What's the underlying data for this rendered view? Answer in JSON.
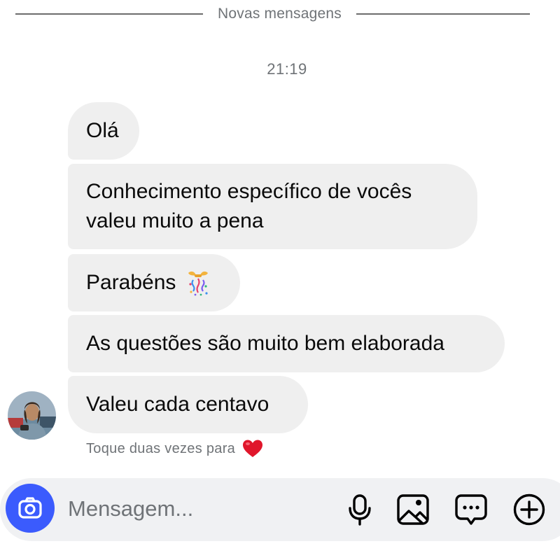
{
  "divider": {
    "label": "Novas mensagens"
  },
  "timestamp": "21:19",
  "messages": [
    {
      "text": "Olá"
    },
    {
      "text": "Conhecimento específico de vocês valeu muito a pena"
    },
    {
      "text": "Parabéns",
      "emoji": "confetti-icon"
    },
    {
      "text": "As questões são muito bem elaborada"
    },
    {
      "text": "Valeu cada centavo"
    }
  ],
  "hint": {
    "text": "Toque duas vezes para",
    "icon": "heart-icon"
  },
  "composer": {
    "placeholder": "Mensagem...",
    "camera_color": "#3b5bfd",
    "tools": [
      "camera-icon",
      "microphone-icon",
      "gallery-icon",
      "sticker-icon",
      "plus-icon"
    ]
  },
  "colors": {
    "bubble": "#efefef",
    "accent": "#3b5bfd",
    "heart": "#e0162b"
  }
}
